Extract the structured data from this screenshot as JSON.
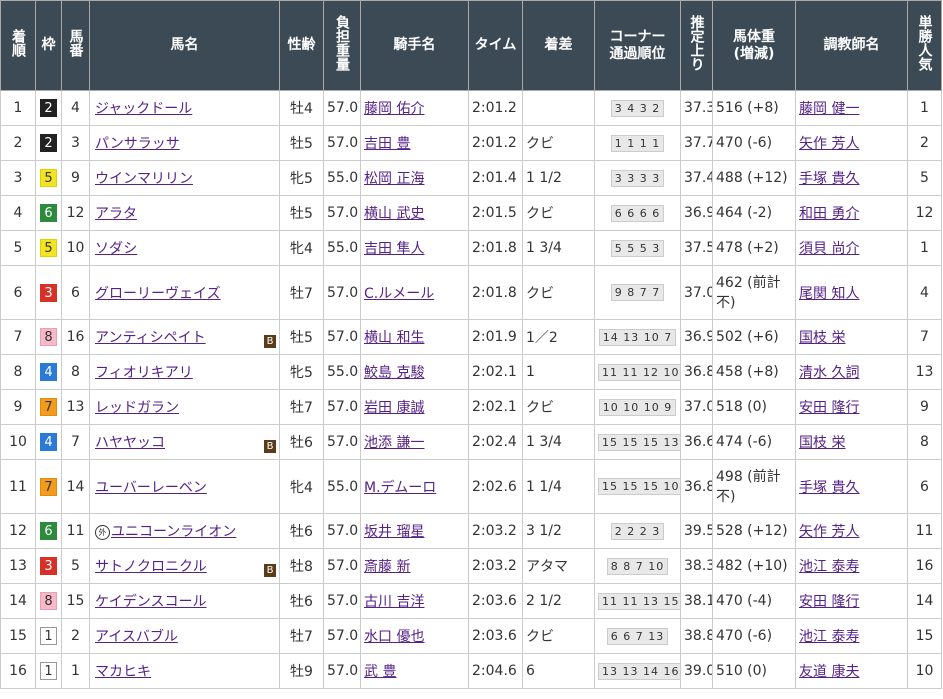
{
  "headers": {
    "rank": "着順",
    "waku": "枠",
    "umaban": "馬番",
    "horse": "馬名",
    "sex_age": "性齢",
    "weight_carried": "負担重量",
    "jockey": "騎手名",
    "time": "タイム",
    "margin": "着差",
    "corner_line1": "コーナー",
    "corner_line2": "通過順位",
    "last3f": "推定上り",
    "body_line1": "馬体重",
    "body_line2": "(増減)",
    "trainer": "調教師名",
    "popularity": "単勝人気"
  },
  "rows": [
    {
      "rank": "1",
      "waku": "2",
      "umaban": "4",
      "horse": "ジャックドール",
      "blinker": "",
      "foreign": "",
      "sex_age": "牡4",
      "kg": "57.0",
      "jockey": "藤岡 佑介",
      "time": "2:01.2",
      "margin": "",
      "corner": "3 4 3 2",
      "last3f": "37.3",
      "body": "516 (+8)",
      "trainer": "藤岡 健一",
      "pop": "1"
    },
    {
      "rank": "2",
      "waku": "2",
      "umaban": "3",
      "horse": "パンサラッサ",
      "blinker": "",
      "foreign": "",
      "sex_age": "牡5",
      "kg": "57.0",
      "jockey": "吉田 豊",
      "time": "2:01.2",
      "margin": "クビ",
      "corner": "1 1 1 1",
      "last3f": "37.7",
      "body": "470 (-6)",
      "trainer": "矢作 芳人",
      "pop": "2"
    },
    {
      "rank": "3",
      "waku": "5",
      "umaban": "9",
      "horse": "ウインマリリン",
      "blinker": "",
      "foreign": "",
      "sex_age": "牝5",
      "kg": "55.0",
      "jockey": "松岡 正海",
      "time": "2:01.4",
      "margin": "1 1/2",
      "corner": "3 3 3 3",
      "last3f": "37.4",
      "body": "488 (+12)",
      "trainer": "手塚 貴久",
      "pop": "5"
    },
    {
      "rank": "4",
      "waku": "6",
      "umaban": "12",
      "horse": "アラタ",
      "blinker": "",
      "foreign": "",
      "sex_age": "牡5",
      "kg": "57.0",
      "jockey": "横山 武史",
      "time": "2:01.5",
      "margin": "クビ",
      "corner": "6 6 6 6",
      "last3f": "36.9",
      "body": "464 (-2)",
      "trainer": "和田 勇介",
      "pop": "12"
    },
    {
      "rank": "5",
      "waku": "5",
      "umaban": "10",
      "horse": "ソダシ",
      "blinker": "",
      "foreign": "",
      "sex_age": "牝4",
      "kg": "55.0",
      "jockey": "吉田 隼人",
      "time": "2:01.8",
      "margin": "1 3/4",
      "corner": "5 5 5 3",
      "last3f": "37.5",
      "body": "478 (+2)",
      "trainer": "須貝 尚介",
      "pop": "1"
    },
    {
      "rank": "6",
      "waku": "3",
      "umaban": "6",
      "horse": "グローリーヴェイズ",
      "blinker": "",
      "foreign": "",
      "sex_age": "牡7",
      "kg": "57.0",
      "jockey": "C.ルメール",
      "time": "2:01.8",
      "margin": "クビ",
      "corner": "9 8 7 7",
      "last3f": "37.0",
      "body": "462 (前計不)",
      "trainer": "尾関 知人",
      "pop": "4",
      "tall": true
    },
    {
      "rank": "7",
      "waku": "8",
      "umaban": "16",
      "horse": "アンティシペイト",
      "blinker": "B",
      "foreign": "",
      "sex_age": "牡5",
      "kg": "57.0",
      "jockey": "横山 和生",
      "time": "2:01.9",
      "margin": "1／2",
      "corner": "14 13 10 7",
      "last3f": "36.9",
      "body": "502 (+6)",
      "trainer": "国枝 栄",
      "pop": "7"
    },
    {
      "rank": "8",
      "waku": "4",
      "umaban": "8",
      "horse": "フィオリキアリ",
      "blinker": "",
      "foreign": "",
      "sex_age": "牝5",
      "kg": "55.0",
      "jockey": "鮫島 克駿",
      "time": "2:02.1",
      "margin": "1",
      "corner": "11 11 12 10",
      "last3f": "36.8",
      "body": "458 (+8)",
      "trainer": "清水 久詞",
      "pop": "13"
    },
    {
      "rank": "9",
      "waku": "7",
      "umaban": "13",
      "horse": "レッドガラン",
      "blinker": "",
      "foreign": "",
      "sex_age": "牡7",
      "kg": "57.0",
      "jockey": "岩田 康誠",
      "time": "2:02.1",
      "margin": "クビ",
      "corner": "10 10 10 9",
      "last3f": "37.0",
      "body": "518 (0)",
      "trainer": "安田 隆行",
      "pop": "9"
    },
    {
      "rank": "10",
      "waku": "4",
      "umaban": "7",
      "horse": "ハヤヤッコ",
      "blinker": "B",
      "foreign": "",
      "sex_age": "牡6",
      "kg": "57.0",
      "jockey": "池添 謙一",
      "time": "2:02.4",
      "margin": "1 3/4",
      "corner": "15 15 15 13",
      "last3f": "36.6",
      "body": "474 (-6)",
      "trainer": "国枝 栄",
      "pop": "8"
    },
    {
      "rank": "11",
      "waku": "7",
      "umaban": "14",
      "horse": "ユーバーレーベン",
      "blinker": "",
      "foreign": "",
      "sex_age": "牝4",
      "kg": "55.0",
      "jockey": "M.デムーロ",
      "time": "2:02.6",
      "margin": "1 1/4",
      "corner": "15 15 15 10",
      "last3f": "36.8",
      "body": "498 (前計不)",
      "trainer": "手塚 貴久",
      "pop": "6",
      "tall": true
    },
    {
      "rank": "12",
      "waku": "6",
      "umaban": "11",
      "horse": "ユニコーンライオン",
      "blinker": "",
      "foreign": "外",
      "sex_age": "牡6",
      "kg": "57.0",
      "jockey": "坂井 瑠星",
      "time": "2:03.2",
      "margin": "3 1/2",
      "corner": "2 2 2 3",
      "last3f": "39.5",
      "body": "528 (+12)",
      "trainer": "矢作 芳人",
      "pop": "11"
    },
    {
      "rank": "13",
      "waku": "3",
      "umaban": "5",
      "horse": "サトノクロニクル",
      "blinker": "B",
      "foreign": "",
      "sex_age": "牡8",
      "kg": "57.0",
      "jockey": "斎藤 新",
      "time": "2:03.2",
      "margin": "アタマ",
      "corner": "8 8 7 10",
      "last3f": "38.3",
      "body": "482 (+10)",
      "trainer": "池江 泰寿",
      "pop": "16"
    },
    {
      "rank": "14",
      "waku": "8",
      "umaban": "15",
      "horse": "ケイデンスコール",
      "blinker": "",
      "foreign": "",
      "sex_age": "牡6",
      "kg": "57.0",
      "jockey": "古川 吉洋",
      "time": "2:03.6",
      "margin": "2 1/2",
      "corner": "11 11 13 15",
      "last3f": "38.1",
      "body": "470 (-4)",
      "trainer": "安田 隆行",
      "pop": "14"
    },
    {
      "rank": "15",
      "waku": "1",
      "umaban": "2",
      "horse": "アイスバブル",
      "blinker": "",
      "foreign": "",
      "sex_age": "牡7",
      "kg": "57.0",
      "jockey": "水口 優也",
      "time": "2:03.6",
      "margin": "クビ",
      "corner": "6 6 7 13",
      "last3f": "38.8",
      "body": "470 (-6)",
      "trainer": "池江 泰寿",
      "pop": "15"
    },
    {
      "rank": "16",
      "waku": "1",
      "umaban": "1",
      "horse": "マカヒキ",
      "blinker": "",
      "foreign": "",
      "sex_age": "牡9",
      "kg": "57.0",
      "jockey": "武 豊",
      "time": "2:04.6",
      "margin": "6",
      "corner": "13 13 14 16",
      "last3f": "39.0",
      "body": "510 (0)",
      "trainer": "友道 康夫",
      "pop": "10"
    }
  ]
}
